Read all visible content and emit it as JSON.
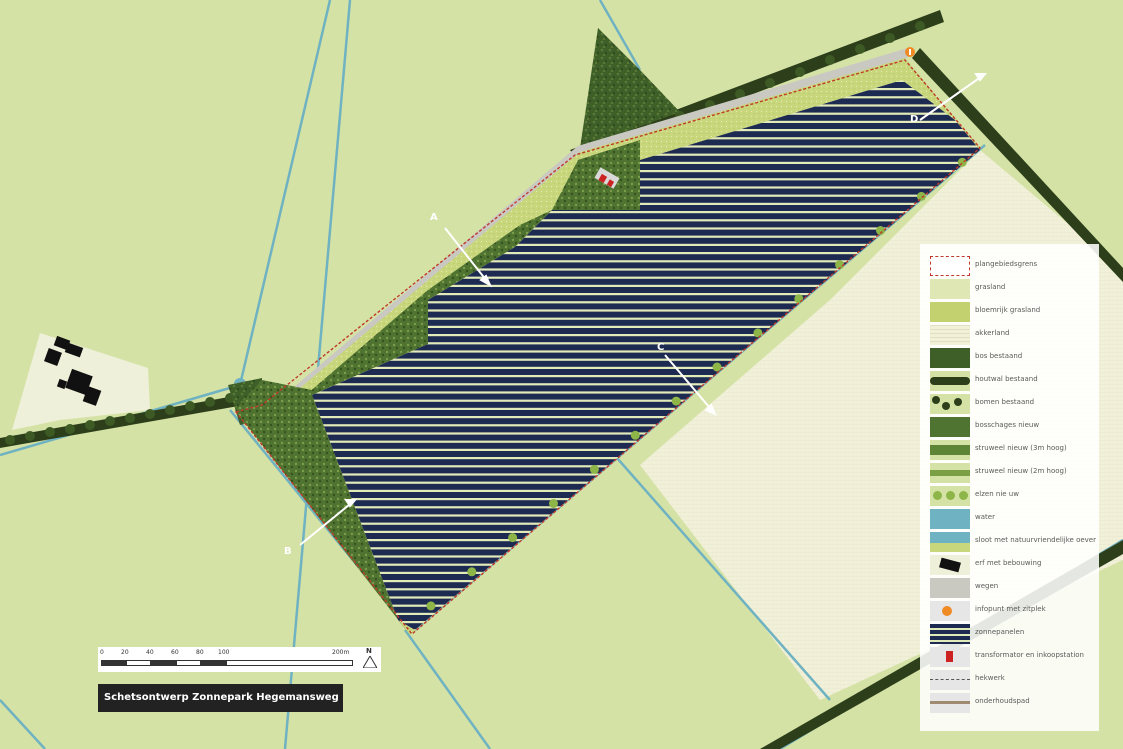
{
  "title": "Schetsontwerp Zonnepark Hegemansweg",
  "sections": [
    "A",
    "B",
    "C",
    "D"
  ],
  "scale": {
    "ticks": [
      "0",
      "20",
      "40",
      "60",
      "80",
      "100",
      "200m"
    ],
    "north": "N"
  },
  "legend": [
    {
      "label": "plangebiedsgrens",
      "icon": "plan-boundary"
    },
    {
      "label": "grasland",
      "icon": "grassland"
    },
    {
      "label": "bloemrijk grasland",
      "icon": "flower-grassland"
    },
    {
      "label": "akkerland",
      "icon": "farmland"
    },
    {
      "label": "bos bestaand",
      "icon": "forest-existing"
    },
    {
      "label": "houtwal bestaand",
      "icon": "wooded-bank"
    },
    {
      "label": "bomen bestaand",
      "icon": "trees-existing"
    },
    {
      "label": "bosschages nieuw",
      "icon": "thicket-new"
    },
    {
      "label": "struweel nieuw (3m hoog)",
      "icon": "shrubs-3m"
    },
    {
      "label": "struweel nieuw (2m hoog)",
      "icon": "shrubs-2m"
    },
    {
      "label": "elzen nie uw",
      "icon": "alders-new"
    },
    {
      "label": "water",
      "icon": "water"
    },
    {
      "label": "sloot met natuurvriendelijke oever",
      "icon": "ditch-eco-bank"
    },
    {
      "label": "erf met bebouwing",
      "icon": "yard-buildings"
    },
    {
      "label": "wegen",
      "icon": "roads"
    },
    {
      "label": "infopunt met zitplek",
      "icon": "info-point"
    },
    {
      "label": "zonnepanelen",
      "icon": "solar-panels"
    },
    {
      "label": "transformator en inkoopstation",
      "icon": "transformer"
    },
    {
      "label": "hekwerk",
      "icon": "fence"
    },
    {
      "label": "onderhoudspad",
      "icon": "maintenance-path"
    }
  ],
  "colors": {
    "grassland": "#d5e2a6",
    "farmland": "#f1f0d8",
    "forest": "#3c5a25",
    "panels": "#1d2b52",
    "water": "#6fb2c1",
    "boundary": "#c0392b"
  }
}
